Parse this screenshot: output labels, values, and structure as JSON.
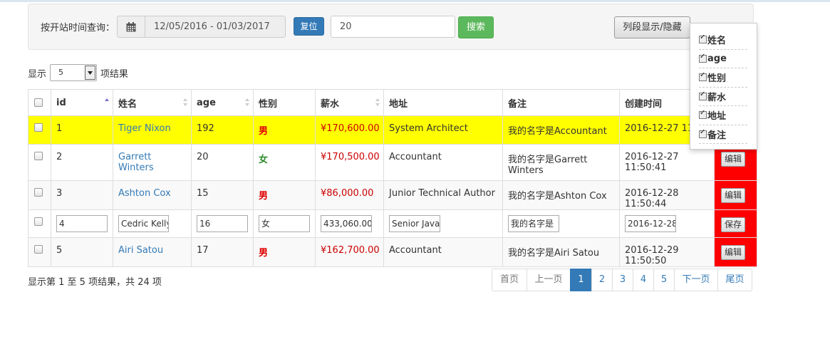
{
  "filter": {
    "label": "按开站时间查询：",
    "date_range": "12/05/2016 - 01/03/2017",
    "reset_label": "复位",
    "search_value": "20",
    "search_label": "搜索",
    "columns_toggle_label": "列段显示/隐藏"
  },
  "length": {
    "prefix": "显示",
    "value": "5",
    "suffix": "项结果"
  },
  "columns": [
    "id",
    "姓名",
    "age",
    "性别",
    "薪水",
    "地址",
    "备注",
    "创建时间"
  ],
  "rows": [
    {
      "id": "1",
      "name": "Tiger Nixon",
      "age": "192",
      "sex": "男",
      "salary": "¥170,600.00",
      "address": "System Architect",
      "note": "我的名字是Accountant",
      "created": "2016-12-27 11:4",
      "action": ""
    },
    {
      "id": "2",
      "name": "Garrett Winters",
      "age": "20",
      "sex": "女",
      "salary": "¥170,500.00",
      "address": "Accountant",
      "note": "我的名字是Garrett Winters",
      "created": "2016-12-27 11:50:41",
      "action": "编辑"
    },
    {
      "id": "3",
      "name": "Ashton Cox",
      "age": "15",
      "sex": "男",
      "salary": "¥86,000.00",
      "address": "Junior Technical Author",
      "note": "我的名字是Ashton Cox",
      "created": "2016-12-28 11:50:44",
      "action": "编辑"
    },
    {
      "id": "4",
      "name": "Cedric Kelly",
      "age": "16",
      "sex": "女",
      "salary": "433,060.00",
      "address": "Senior Java",
      "note": "我的名字是",
      "created": "2016-12-28",
      "action": "保存"
    },
    {
      "id": "5",
      "name": "Airi Satou",
      "age": "17",
      "sex": "男",
      "salary": "¥162,700.00",
      "address": "Accountant",
      "note": "我的名字是Airi Satou",
      "created": "2016-12-29 11:50:50",
      "action": "编辑"
    }
  ],
  "info": "显示第 1 至 5 项结果，共 24 项",
  "pagination": [
    "首页",
    "上一页",
    "1",
    "2",
    "3",
    "4",
    "5",
    "下一页",
    "尾页"
  ],
  "column_toggle": [
    "姓名",
    "age",
    "性别",
    "薪水",
    "地址",
    "备注"
  ],
  "colors": {
    "highlight_row": "#ffff00",
    "action_cell": "#ff0000",
    "primary": "#337ab7",
    "success": "#5cb85c"
  }
}
